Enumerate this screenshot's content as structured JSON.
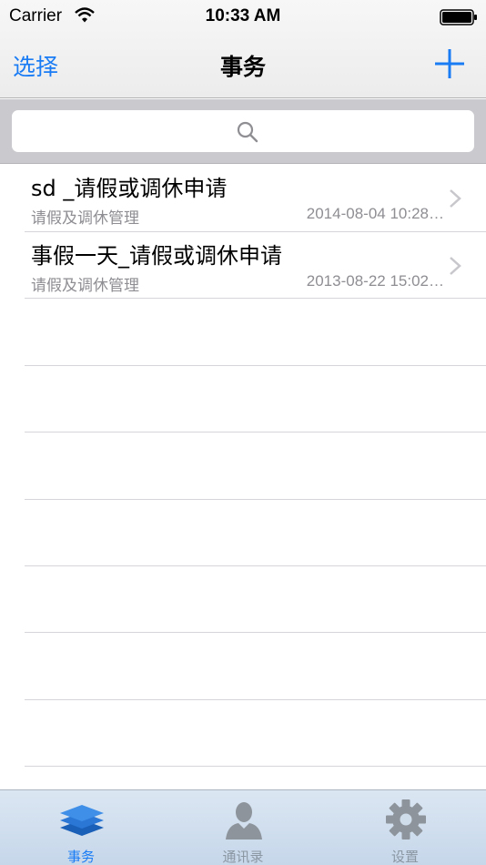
{
  "status_bar": {
    "carrier": "Carrier",
    "time": "10:33 AM"
  },
  "nav": {
    "left_button": "选择",
    "title": "事务",
    "add_icon": "plus-icon"
  },
  "search": {
    "placeholder": "",
    "icon": "search-icon"
  },
  "rows": [
    {
      "title": "sd _请假或调休申请",
      "subtitle": "请假及调休管理",
      "date": "2014-08-04 10:28…"
    },
    {
      "title": "事假一天_请假或调休申请",
      "subtitle": "请假及调休管理",
      "date": "2013-08-22 15:02…"
    }
  ],
  "tabs": [
    {
      "label": "事务",
      "icon": "stack-icon",
      "active": true
    },
    {
      "label": "通讯录",
      "icon": "person-icon",
      "active": false
    },
    {
      "label": "设置",
      "icon": "gear-icon",
      "active": false
    }
  ],
  "colors": {
    "accent": "#1a7cf5",
    "secondary_text": "#8e8e93",
    "search_band": "#c9c9ce",
    "tab_bar": "#c6d7ea"
  }
}
